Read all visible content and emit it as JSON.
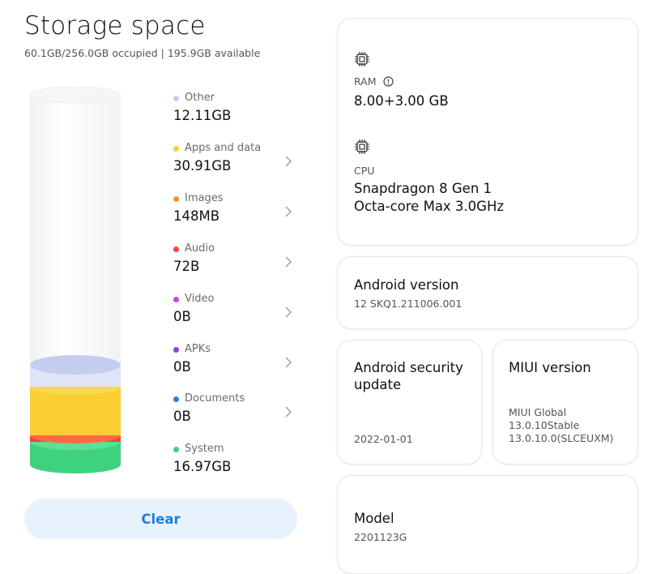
{
  "storage": {
    "title": "Storage space",
    "summary": "60.1GB/256.0GB occupied | 195.9GB available",
    "categories": [
      {
        "label": "Other",
        "value": "12.11GB",
        "color": "#c5cdf0",
        "chevron": false
      },
      {
        "label": "Apps and data",
        "value": "30.91GB",
        "color": "#f9cf34",
        "chevron": true
      },
      {
        "label": "Images",
        "value": "148MB",
        "color": "#ff8f2e",
        "chevron": true
      },
      {
        "label": "Audio",
        "value": "72B",
        "color": "#f2443f",
        "chevron": true
      },
      {
        "label": "Video",
        "value": "0B",
        "color": "#c844de",
        "chevron": true
      },
      {
        "label": "APKs",
        "value": "0B",
        "color": "#8a45d6",
        "chevron": true
      },
      {
        "label": "Documents",
        "value": "0B",
        "color": "#2f7be0",
        "chevron": true
      },
      {
        "label": "System",
        "value": "16.97GB",
        "color": "#3ed27e",
        "chevron": false
      }
    ],
    "clear_label": "Clear"
  },
  "specs": {
    "ram": {
      "icon": "chip-icon",
      "label": "RAM",
      "info_icon": "info-icon",
      "value": "8.00+3.00 GB"
    },
    "cpu": {
      "icon": "chip-icon",
      "label": "CPU",
      "line1": "Snapdragon 8 Gen 1",
      "line2": "Octa-core Max 3.0GHz"
    },
    "android": {
      "title": "Android version",
      "value": "12 SKQ1.211006.001"
    },
    "security": {
      "title_line1": "Android security",
      "title_line2": "update",
      "value": "2022-01-01"
    },
    "miui": {
      "title": "MIUI version",
      "line1": "MIUI Global",
      "line2": "13.0.10Stable",
      "line3": "13.0.10.0(SLCEUXM)"
    },
    "model": {
      "title": "Model",
      "value": "2201123G"
    }
  },
  "colors": {
    "accent": "#1a7ee0",
    "button_bg": "#e8f2fc"
  }
}
